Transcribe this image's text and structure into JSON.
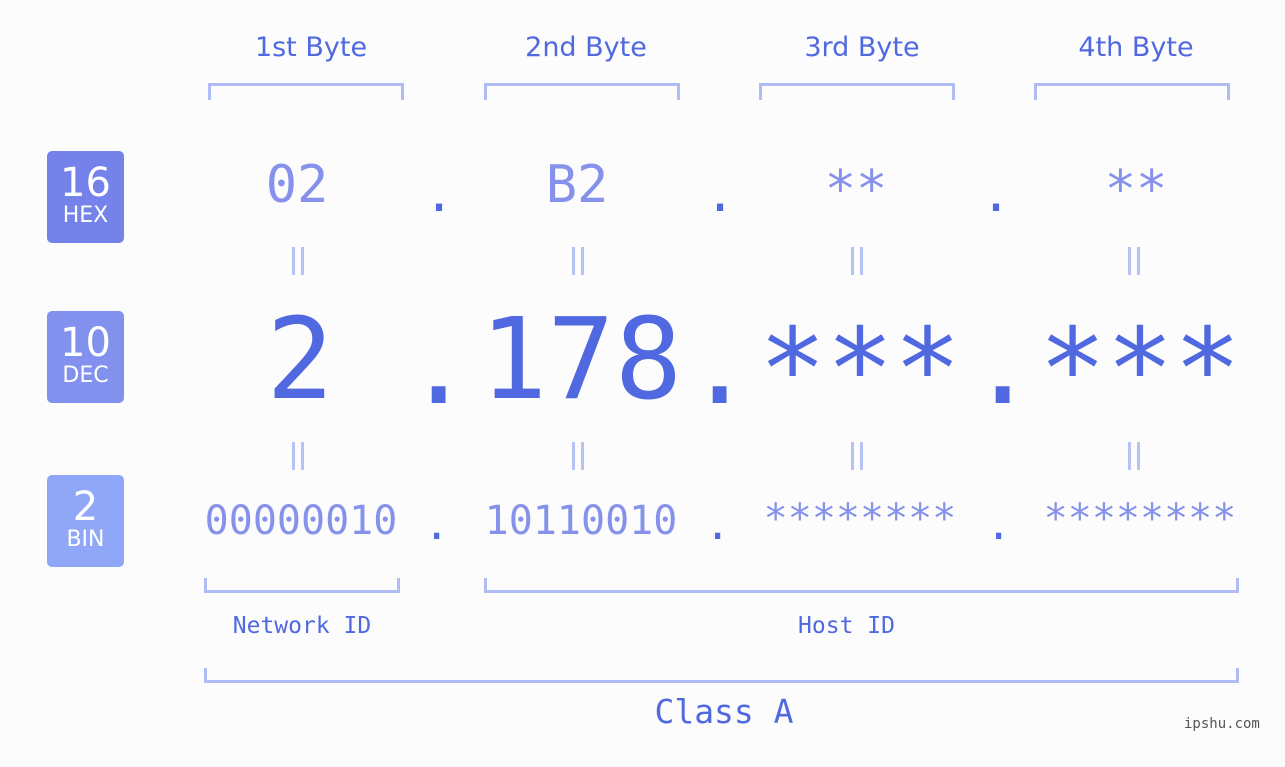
{
  "bytes": [
    {
      "title": "1st Byte",
      "hex": "02",
      "dec": "2",
      "bin": "00000010"
    },
    {
      "title": "2nd Byte",
      "hex": "B2",
      "dec": "178",
      "bin": "10110010"
    },
    {
      "title": "3rd Byte",
      "hex": "**",
      "dec": "***",
      "bin": "********"
    },
    {
      "title": "4th Byte",
      "hex": "**",
      "dec": "***",
      "bin": "********"
    }
  ],
  "badges": [
    {
      "num": "16",
      "label": "HEX",
      "color": "#7482ea"
    },
    {
      "num": "10",
      "label": "DEC",
      "color": "#8391ee"
    },
    {
      "num": "2",
      "label": "BIN",
      "color": "#90a7f8"
    }
  ],
  "separator": ".",
  "network_label": "Network ID",
  "host_label": "Host ID",
  "class_label": "Class A",
  "watermark": "ipshu.com"
}
